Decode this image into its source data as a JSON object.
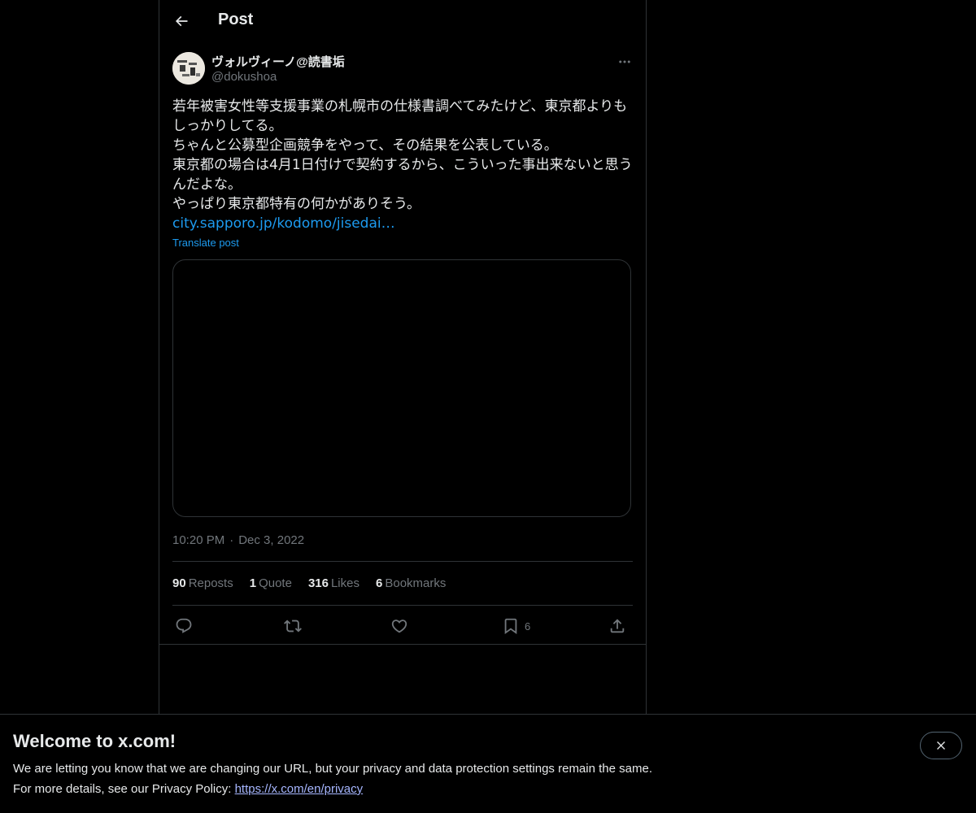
{
  "header": {
    "title": "Post"
  },
  "post": {
    "author_name": "ヴォルヴィーノ@読書垢",
    "author_handle": "@dokushoa",
    "text_lines": [
      "若年被害女性等支援事業の札幌市の仕様書調べてみたけど、東京都よりもしっかりしてる。",
      "ちゃんと公募型企画競争をやって、その結果を公表している。",
      "東京都の場合は4月1日付けで契約するから、こういった事出来ないと思うんだよな。",
      "やっぱり東京都特有の何かがありそう。"
    ],
    "link_text": "city.sapporo.jp/kodomo/jisedai…",
    "translate_label": "Translate post",
    "time": "10:20 PM",
    "date": "Dec 3, 2022",
    "stats": {
      "reposts_count": "90",
      "reposts_label": "Reposts",
      "quotes_count": "1",
      "quotes_label": "Quote",
      "likes_count": "316",
      "likes_label": "Likes",
      "bookmarks_count": "6",
      "bookmarks_label": "Bookmarks"
    },
    "actions": {
      "bookmark_count": "6"
    }
  },
  "banner": {
    "title": "Welcome to x.com!",
    "line1": "We are letting you know that we are changing our URL, but your privacy and data protection settings remain the same.",
    "line2_prefix": "For more details, see our Privacy Policy: ",
    "link": "https://x.com/en/privacy"
  },
  "colors": {
    "background": "#000000",
    "text": "#e7e9ea",
    "muted": "#71767b",
    "accent": "#1d9bf0",
    "border": "#2f3336"
  },
  "icons": [
    "back-arrow-icon",
    "more-icon",
    "reply-icon",
    "repost-icon",
    "like-icon",
    "bookmark-icon",
    "share-icon",
    "close-icon"
  ]
}
